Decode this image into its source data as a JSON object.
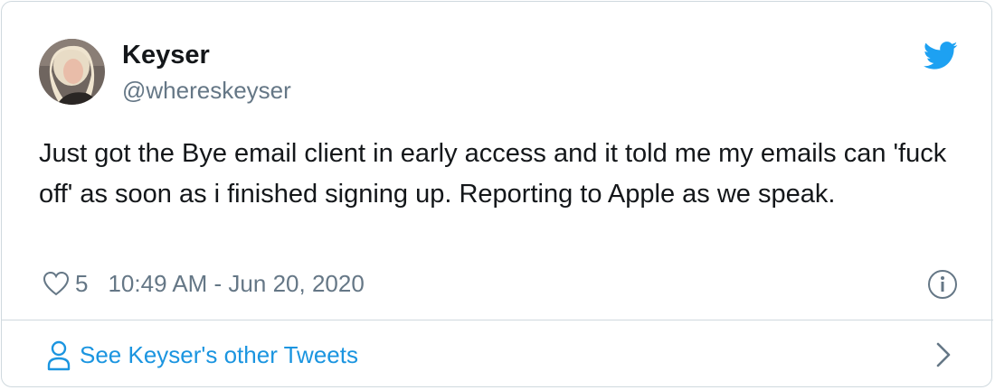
{
  "tweet": {
    "author_name": "Keyser",
    "author_handle": "@whereskeyser",
    "text": "Just got the Bye email client in early access and it told me my emails can 'fuck off' as soon as i finished signing up. Reporting to Apple as we speak.",
    "like_count": "5",
    "timestamp": "10:49 AM - Jun 20, 2020"
  },
  "footer": {
    "label": "See Keyser's other Tweets"
  },
  "icons": {
    "brand": "twitter-bird-icon",
    "like": "heart-icon",
    "info": "info-icon",
    "profile": "person-icon",
    "next": "chevron-right-icon"
  },
  "colors": {
    "accent": "#1da1f2",
    "link": "#1b95e0",
    "text": "#14171a",
    "secondary": "#657786",
    "border": "#cfd9de"
  }
}
